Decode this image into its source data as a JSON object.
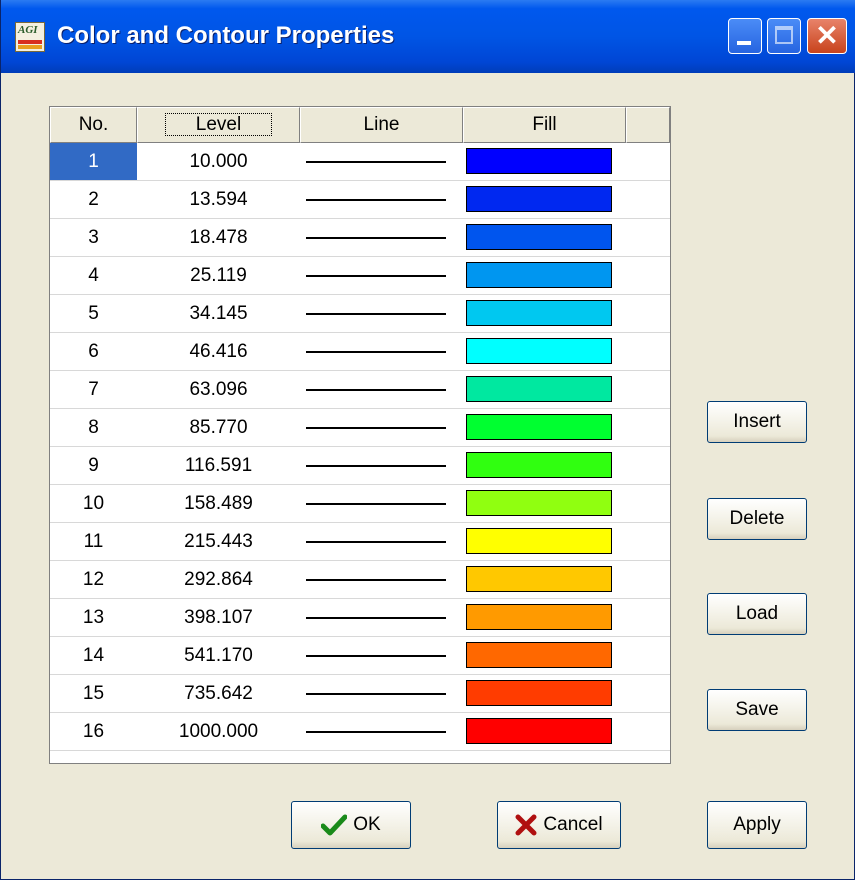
{
  "window": {
    "title": "Color and Contour Properties",
    "app_icon": "agi-app-icon",
    "icon_text": "AGI"
  },
  "titlebar_buttons": {
    "minimize": "minimize-icon",
    "maximize": "maximize-icon",
    "close": "close-icon"
  },
  "table": {
    "columns": [
      "No.",
      "Level",
      "Line",
      "Fill"
    ],
    "selected_row": 1,
    "rows": [
      {
        "no": "1",
        "level": "10.000",
        "fill": "#0000FF"
      },
      {
        "no": "2",
        "level": "13.594",
        "fill": "#0028F0"
      },
      {
        "no": "3",
        "level": "18.478",
        "fill": "#0055EE"
      },
      {
        "no": "4",
        "level": "25.119",
        "fill": "#0096F0"
      },
      {
        "no": "5",
        "level": "34.145",
        "fill": "#00C8F0"
      },
      {
        "no": "6",
        "level": "46.416",
        "fill": "#00FFFF"
      },
      {
        "no": "7",
        "level": "63.096",
        "fill": "#00E8A0"
      },
      {
        "no": "8",
        "level": "85.770",
        "fill": "#00FF30"
      },
      {
        "no": "9",
        "level": "116.591",
        "fill": "#30FF10"
      },
      {
        "no": "10",
        "level": "158.489",
        "fill": "#90FF10"
      },
      {
        "no": "11",
        "level": "215.443",
        "fill": "#FFFF00"
      },
      {
        "no": "12",
        "level": "292.864",
        "fill": "#FFC800"
      },
      {
        "no": "13",
        "level": "398.107",
        "fill": "#FF9A00"
      },
      {
        "no": "14",
        "level": "541.170",
        "fill": "#FF6800"
      },
      {
        "no": "15",
        "level": "735.642",
        "fill": "#FF3C00"
      },
      {
        "no": "16",
        "level": "1000.000",
        "fill": "#FF0000"
      }
    ]
  },
  "side_buttons": {
    "insert": "Insert",
    "delete": "Delete",
    "load": "Load",
    "save": "Save"
  },
  "bottom_buttons": {
    "ok": "OK",
    "cancel": "Cancel",
    "apply": "Apply"
  },
  "colors": {
    "selection": "#316AC5",
    "dialog_bg": "#ECE9D8",
    "titlebar": "#0055E5"
  }
}
